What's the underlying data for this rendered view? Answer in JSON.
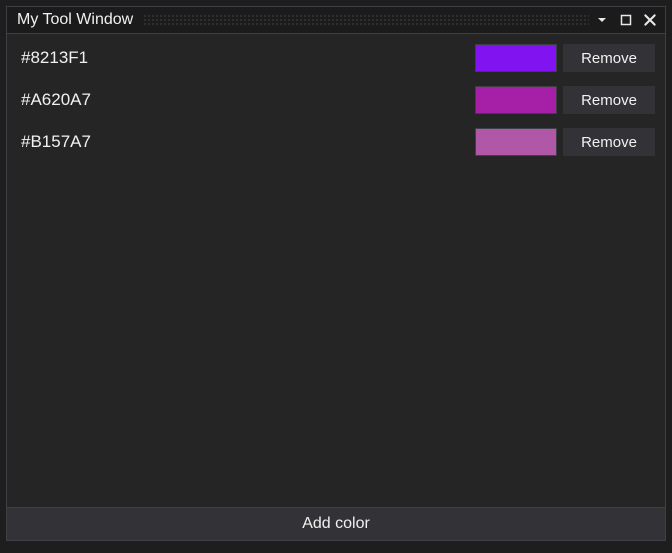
{
  "window": {
    "title": "My Tool Window"
  },
  "colors": [
    {
      "hex": "#8213F1",
      "swatch": "#8213F1",
      "remove_label": "Remove"
    },
    {
      "hex": "#A620A7",
      "swatch": "#A620A7",
      "remove_label": "Remove"
    },
    {
      "hex": "#B157A7",
      "swatch": "#B157A7",
      "remove_label": "Remove"
    }
  ],
  "footer": {
    "add_label": "Add color"
  }
}
